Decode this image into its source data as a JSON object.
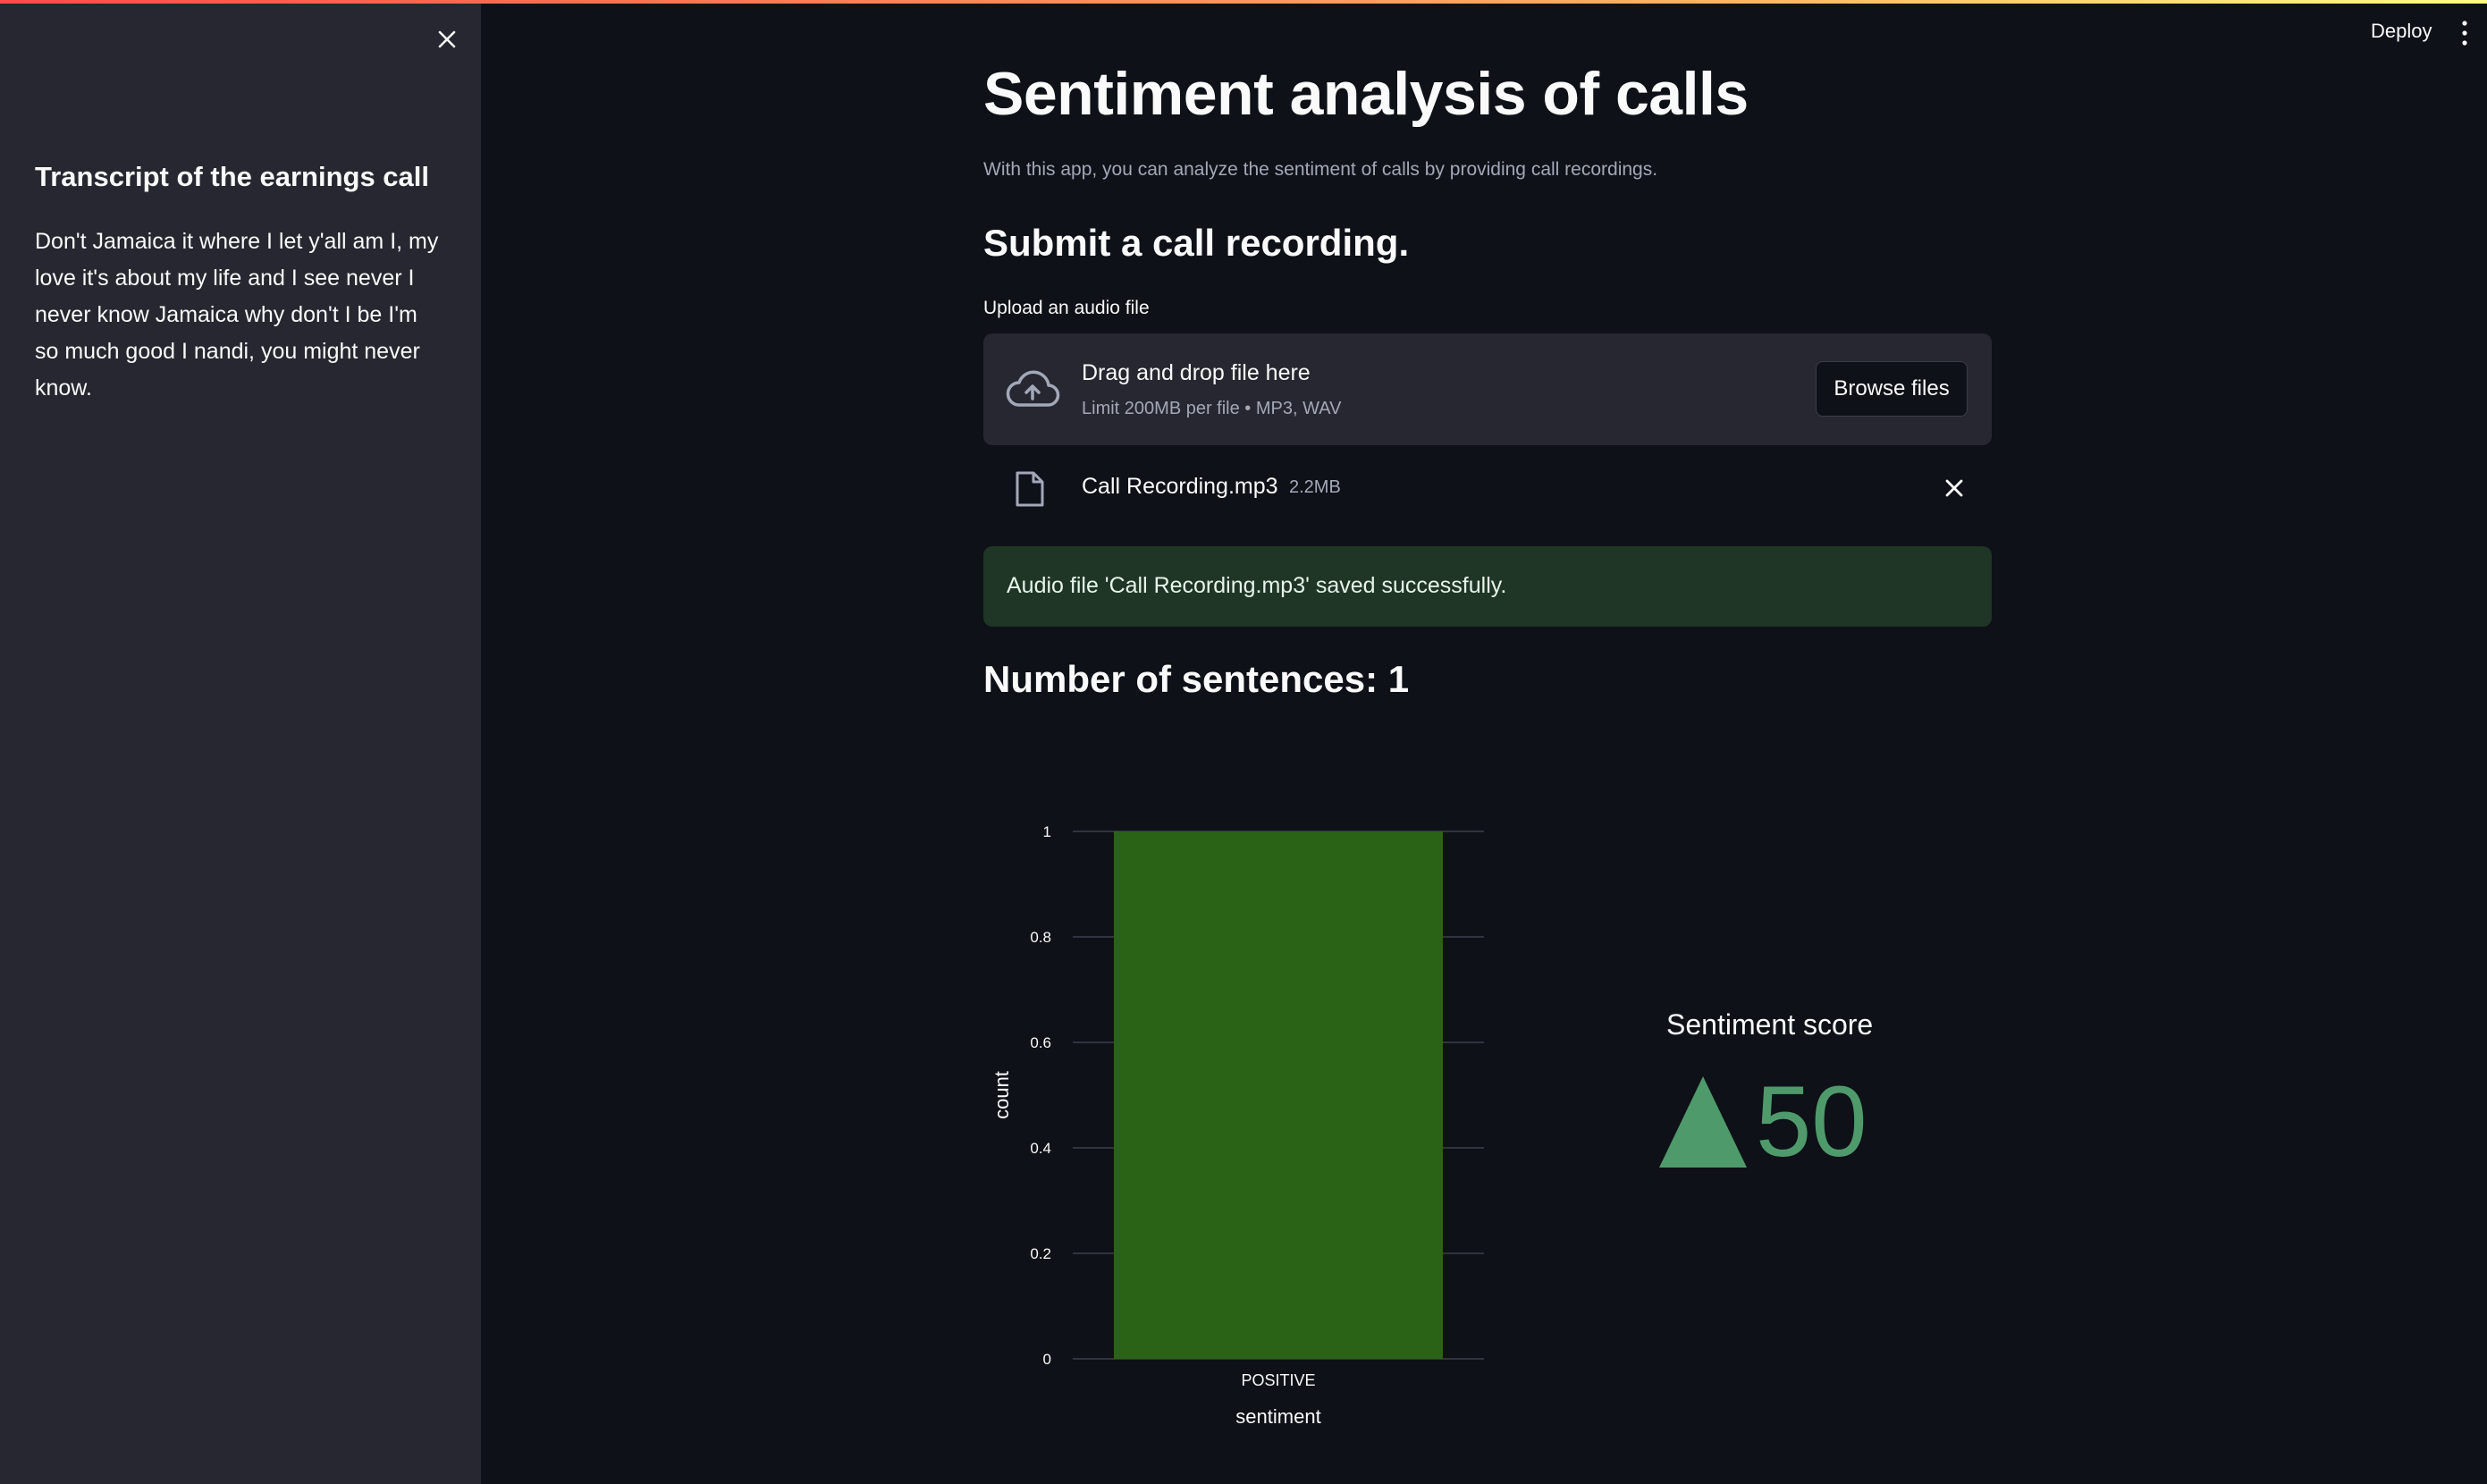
{
  "colors": {
    "accent_green": "#4f9a6b",
    "bar_green": "#2a6316",
    "alert_bg": "#1f3526"
  },
  "header": {
    "deploy": "Deploy"
  },
  "sidebar": {
    "title": "Transcript of the earnings call",
    "transcript": "Don't Jamaica it where I let y'all am I, my love it's about my life and I see never I never know Jamaica why don't I be I'm so much good I nandi, you might never know."
  },
  "main": {
    "title": "Sentiment analysis of calls",
    "subtitle": "With this app, you can analyze the sentiment of calls by providing call recordings.",
    "submit_heading": "Submit a call recording.",
    "uploader": {
      "label": "Upload an audio file",
      "drop_text": "Drag and drop file here",
      "limit_text": "Limit 200MB per file • MP3, WAV",
      "browse": "Browse files"
    },
    "uploaded_file": {
      "name": "Call Recording.mp3",
      "size": "2.2MB"
    },
    "success_message": "Audio file 'Call Recording.mp3' saved successfully.",
    "count_heading": "Number of sentences: 1",
    "metric": {
      "label": "Sentiment score",
      "value": "50"
    }
  },
  "chart_data": {
    "type": "bar",
    "categories": [
      "POSITIVE"
    ],
    "values": [
      1
    ],
    "xlabel": "sentiment",
    "ylabel": "count",
    "ylim": [
      0,
      1
    ],
    "yticks": [
      "0",
      "0.2",
      "0.4",
      "0.6",
      "0.8",
      "1"
    ],
    "grid": true
  }
}
